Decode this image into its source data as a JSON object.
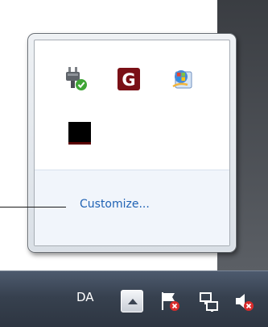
{
  "flyout": {
    "customize_label": "Customize...",
    "icons": [
      {
        "name": "power-plug-icon",
        "status": "check"
      },
      {
        "name": "g-app-icon",
        "letter": "G"
      },
      {
        "name": "windows-update-icon"
      },
      {
        "name": "black-square-app-icon"
      }
    ]
  },
  "taskbar": {
    "language": "DA",
    "tray_icons": [
      "action-center-flag-icon",
      "network-icon",
      "volume-muted-icon"
    ]
  },
  "colors": {
    "link": "#1f62b4",
    "g_icon_bg": "#7a1016",
    "status_green": "#3fa535",
    "error_red": "#d92b2b"
  }
}
